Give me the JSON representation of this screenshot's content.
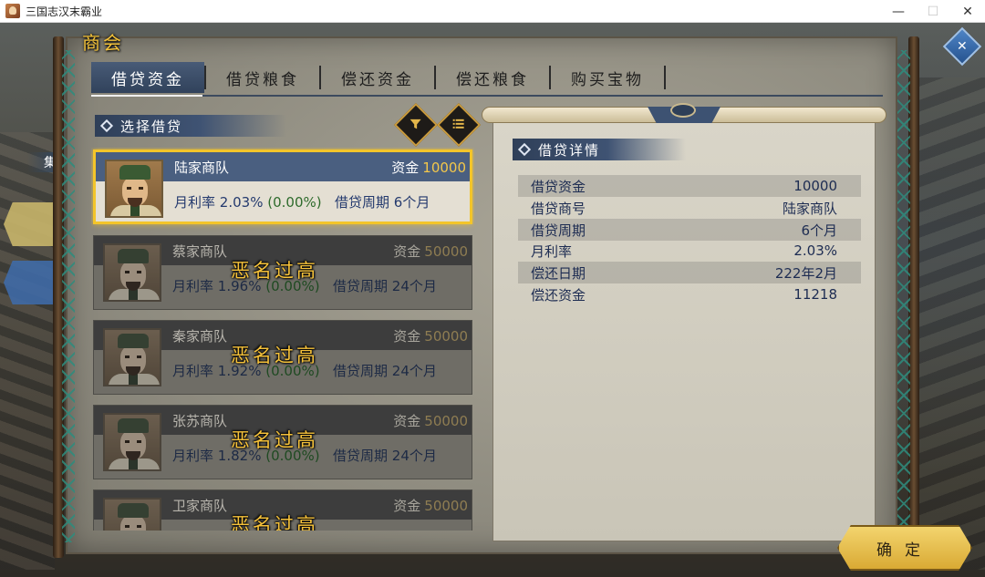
{
  "window": {
    "title": "三国志汉末霸业",
    "controls": [
      "—",
      "☐",
      "✕"
    ]
  },
  "panel": {
    "title": "商会"
  },
  "tabs": [
    {
      "label": "借贷资金",
      "active": true
    },
    {
      "label": "借贷粮食",
      "active": false
    },
    {
      "label": "偿还资金",
      "active": false
    },
    {
      "label": "偿还粮食",
      "active": false
    },
    {
      "label": "购买宝物",
      "active": false
    }
  ],
  "left_section": {
    "title": "选择借贷"
  },
  "icons": {
    "filter": "filter-icon",
    "list": "list-icon"
  },
  "side_tab": {
    "label": "集"
  },
  "loans": [
    {
      "name": "陆家商队",
      "fund_label": "资金",
      "fund": "10000",
      "rate_label": "月利率",
      "rate": "2.03%",
      "rate_change": "(0.00%)",
      "period_label": "借贷周期",
      "period": "6个月",
      "selected": true,
      "warning": ""
    },
    {
      "name": "蔡家商队",
      "fund_label": "资金",
      "fund": "50000",
      "rate_label": "月利率",
      "rate": "1.96%",
      "rate_change": "(0.00%)",
      "period_label": "借贷周期",
      "period": "24个月",
      "selected": false,
      "warning": "恶名过高"
    },
    {
      "name": "秦家商队",
      "fund_label": "资金",
      "fund": "50000",
      "rate_label": "月利率",
      "rate": "1.92%",
      "rate_change": "(0.00%)",
      "period_label": "借贷周期",
      "period": "24个月",
      "selected": false,
      "warning": "恶名过高"
    },
    {
      "name": "张苏商队",
      "fund_label": "资金",
      "fund": "50000",
      "rate_label": "月利率",
      "rate": "1.82%",
      "rate_change": "(0.00%)",
      "period_label": "借贷周期",
      "period": "24个月",
      "selected": false,
      "warning": "恶名过高"
    },
    {
      "name": "卫家商队",
      "fund_label": "资金",
      "fund": "50000",
      "rate_label": "",
      "rate": "",
      "rate_change": "",
      "period_label": "",
      "period": "",
      "selected": false,
      "warning": "恶名过高"
    }
  ],
  "detail": {
    "title": "借贷详情",
    "rows": [
      {
        "label": "借贷资金",
        "value": "10000"
      },
      {
        "label": "借贷商号",
        "value": "陆家商队"
      },
      {
        "label": "借贷周期",
        "value": "6个月"
      },
      {
        "label": "月利率",
        "value": "2.03%"
      },
      {
        "label": "偿还日期",
        "value": "222年2月"
      },
      {
        "label": "偿还资金",
        "value": "11218"
      }
    ]
  },
  "confirm": {
    "label": "确定"
  },
  "colors": {
    "accent_gold": "#f3c23a",
    "tab_active": "#3a4d69",
    "rate_green": "#2e6b2c",
    "text_blue": "#243a6e"
  }
}
